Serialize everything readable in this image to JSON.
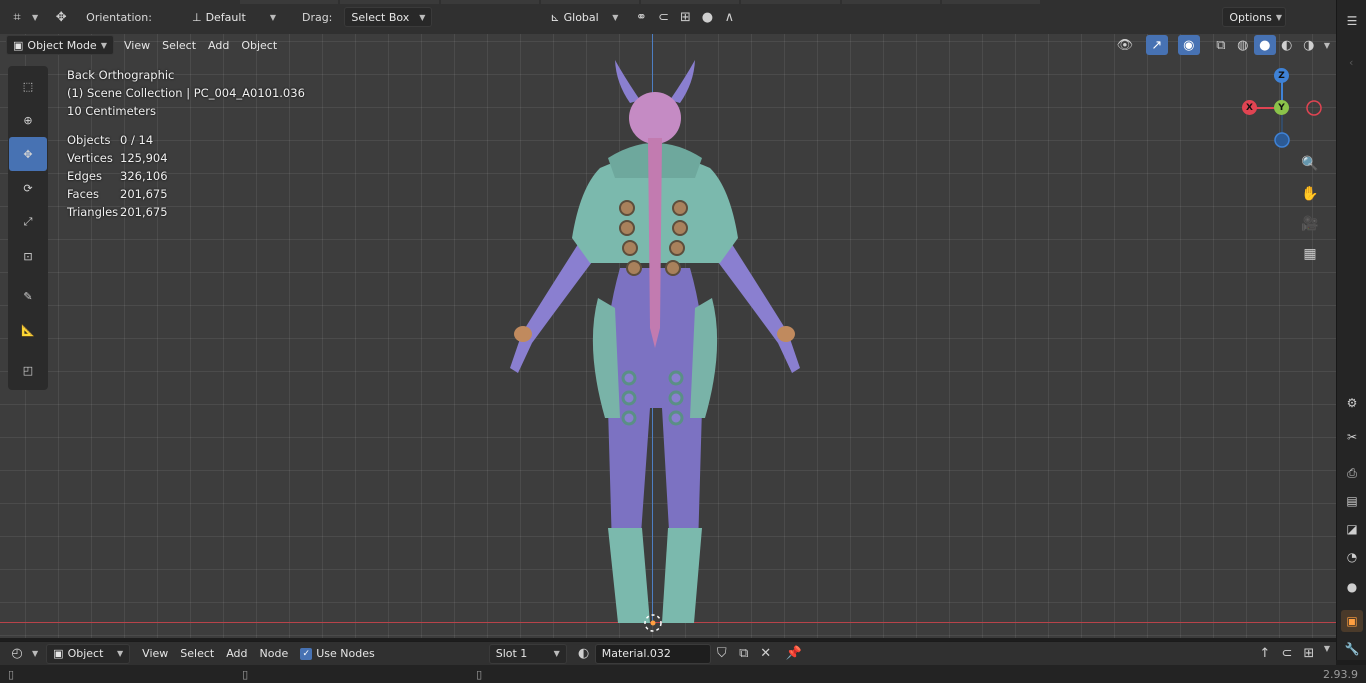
{
  "top_header": {
    "orientation_label": "Orientation:",
    "orientation_value": "Default",
    "drag_label": "Drag:",
    "drag_value": "Select Box",
    "transform_space": "Global",
    "options_label": "Options"
  },
  "viewport_header": {
    "mode": "Object Mode",
    "menus": [
      "View",
      "Select",
      "Add",
      "Object"
    ]
  },
  "overlay": {
    "view_name": "Back Orthographic",
    "collection": "(1) Scene Collection | PC_004_A0101.036",
    "scale": "10 Centimeters",
    "stats": [
      {
        "label": "Objects",
        "value": "0 / 14"
      },
      {
        "label": "Vertices",
        "value": "125,904"
      },
      {
        "label": "Edges",
        "value": "326,106"
      },
      {
        "label": "Faces",
        "value": "201,675"
      },
      {
        "label": "Triangles",
        "value": "201,675"
      }
    ]
  },
  "gizmo": {
    "x": "X",
    "y": "Y",
    "z": "Z",
    "colors": {
      "x": "#e04452",
      "y": "#8bc34a",
      "z": "#3f82d6"
    }
  },
  "tools": [
    "select-box-icon",
    "cursor-icon",
    "move-icon",
    "rotate-icon",
    "scale-icon",
    "transform-icon",
    "annotate-icon",
    "measure-icon",
    "add-cube-icon"
  ],
  "navigation": [
    "zoom-icon",
    "pan-hand-icon",
    "camera-icon",
    "grid-icon"
  ],
  "bottom_header": {
    "editor_mode": "Object",
    "menus": [
      "View",
      "Select",
      "Add",
      "Node"
    ],
    "use_nodes_label": "Use Nodes",
    "slot": "Slot 1",
    "material": "Material.032"
  },
  "status": {
    "version": "2.93.9"
  },
  "colors": {
    "accent": "#4772b3",
    "axis_x": "#b8434a",
    "axis_z": "#4d7ec2"
  }
}
